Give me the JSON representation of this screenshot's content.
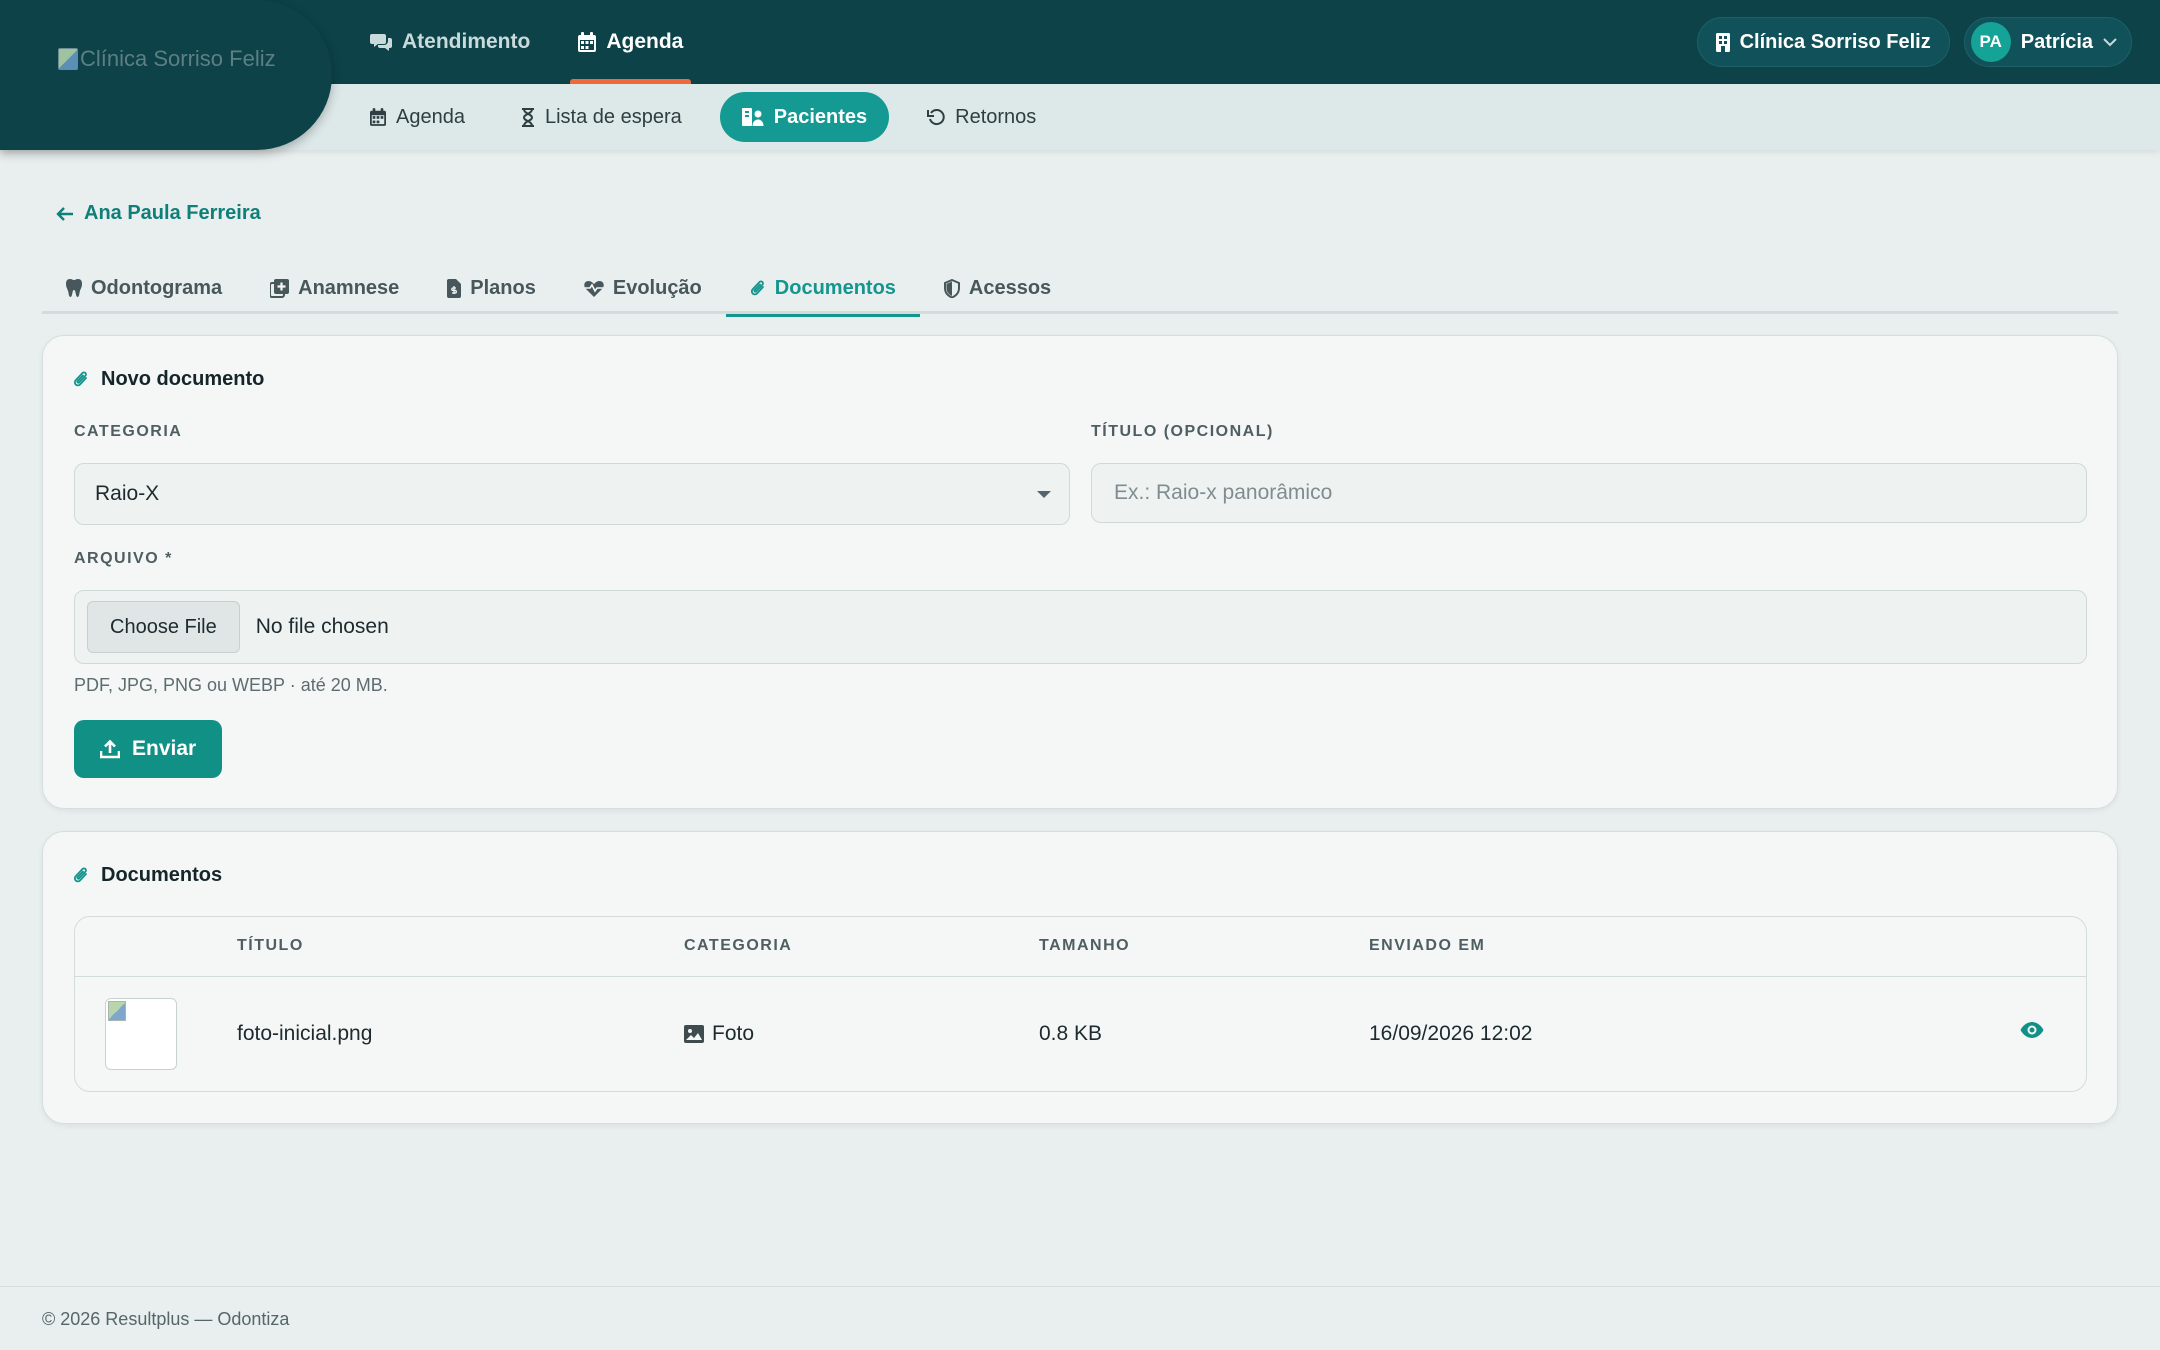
{
  "brand": {
    "logo_alt": "Clínica Sorriso Feliz"
  },
  "main_nav": [
    {
      "label": "Atendimento",
      "icon": "comments-icon"
    },
    {
      "label": "Agenda",
      "icon": "calendar-icon",
      "active": true
    }
  ],
  "top_right": {
    "clinic": "Clínica Sorriso Feliz",
    "initials": "PA",
    "user": "Patrícia"
  },
  "sub_nav": [
    {
      "label": "Agenda",
      "icon": "calendar-icon"
    },
    {
      "label": "Lista de espera",
      "icon": "hourglass-icon"
    },
    {
      "label": "Pacientes",
      "icon": "patients-icon",
      "active": true
    },
    {
      "label": "Retornos",
      "icon": "undo-icon"
    }
  ],
  "breadcrumb": {
    "back_label": "Ana Paula Ferreira"
  },
  "tabs": [
    {
      "label": "Odontograma",
      "icon": "tooth-icon"
    },
    {
      "label": "Anamnese",
      "icon": "notes-medical-icon"
    },
    {
      "label": "Planos",
      "icon": "file-invoice-icon"
    },
    {
      "label": "Evolução",
      "icon": "heart-pulse-icon"
    },
    {
      "label": "Documentos",
      "icon": "paperclip-icon",
      "active": true
    },
    {
      "label": "Acessos",
      "icon": "shield-icon"
    }
  ],
  "new_document": {
    "title": "Novo documento",
    "category_label": "CATEGORIA",
    "category_value": "Raio-X",
    "title_label": "TÍTULO (OPCIONAL)",
    "title_placeholder": "Ex.: Raio-x panorâmico",
    "file_label": "ARQUIVO *",
    "file_button": "Choose File",
    "file_status": "No file chosen",
    "hint": "PDF, JPG, PNG ou WEBP · até 20 MB.",
    "submit": "Enviar"
  },
  "documents": {
    "title": "Documentos",
    "columns": [
      "TÍTULO",
      "CATEGORIA",
      "TAMANHO",
      "ENVIADO EM"
    ],
    "rows": [
      {
        "title": "foto-inicial.png",
        "category": "Foto",
        "size": "0.8 KB",
        "sent_at": "16/09/2026 12:02"
      }
    ]
  },
  "footer": {
    "text": "© 2026 Resultplus — Odontiza"
  },
  "colors": {
    "primary": "#0c4248",
    "accent": "#14958e",
    "highlight": "#ee6a3c"
  }
}
